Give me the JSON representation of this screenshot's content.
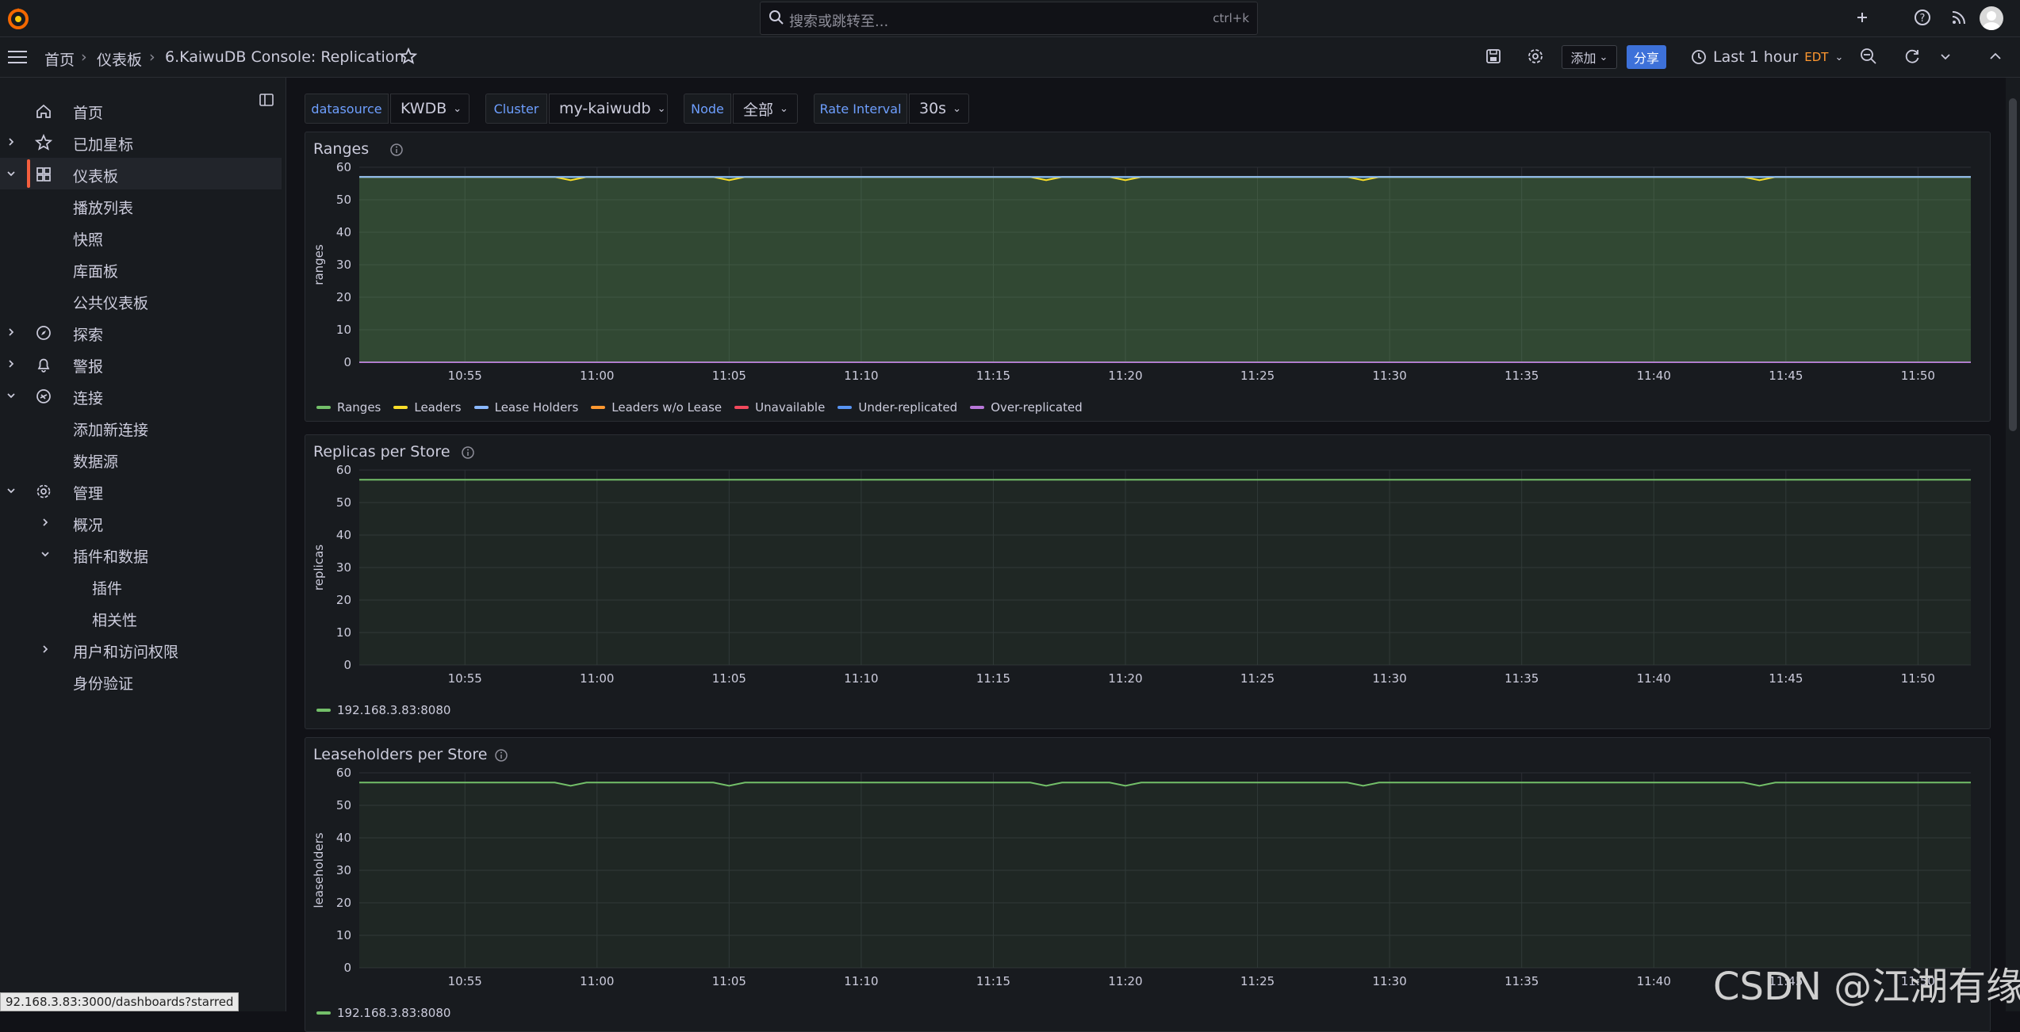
{
  "topbar": {
    "search_placeholder": "搜索或跳转至...",
    "search_shortcut": "ctrl+k"
  },
  "breadcrumb": [
    "首页",
    "仪表板",
    "6.KaiwuDB Console: Replication"
  ],
  "toolbar": {
    "add_label": "添加",
    "share_label": "分享",
    "time_range": "Last 1 hour",
    "timezone": "EDT"
  },
  "sidebar": {
    "items": [
      {
        "label": "首页",
        "icon": "home-icon"
      },
      {
        "label": "已加星标",
        "icon": "star-icon",
        "chevron": "right"
      },
      {
        "label": "仪表板",
        "icon": "dashboards-icon",
        "chevron": "down",
        "active": true
      },
      {
        "label": "播放列表"
      },
      {
        "label": "快照"
      },
      {
        "label": "库面板"
      },
      {
        "label": "公共仪表板"
      },
      {
        "label": "探索",
        "icon": "compass-icon",
        "chevron": "right"
      },
      {
        "label": "警报",
        "icon": "bell-icon",
        "chevron": "right"
      },
      {
        "label": "连接",
        "icon": "link-icon",
        "chevron": "down"
      },
      {
        "label": "添加新连接"
      },
      {
        "label": "数据源"
      },
      {
        "label": "管理",
        "icon": "gear-icon",
        "chevron": "down"
      },
      {
        "label": "概况",
        "chevron": "right"
      },
      {
        "label": "插件和数据",
        "chevron": "down"
      },
      {
        "label": "插件"
      },
      {
        "label": "相关性"
      },
      {
        "label": "用户和访问权限",
        "chevron": "right"
      },
      {
        "label": "身份验证"
      }
    ]
  },
  "variables": [
    {
      "label": "datasource",
      "value": "KWDB"
    },
    {
      "label": "Cluster",
      "value": "my-kaiwudb"
    },
    {
      "label": "Node",
      "value": "全部"
    },
    {
      "label": "Rate Interval",
      "value": "30s"
    }
  ],
  "colors": {
    "green": "#73bf69",
    "yellow": "#fade2a",
    "blue": "#8ab8ff",
    "orange": "#ff9830",
    "red": "#f2495c",
    "blue2": "#5794f2",
    "purple": "#b877d9",
    "accent": "#f55f3e"
  },
  "chart_data": [
    {
      "type": "line",
      "title": "Ranges",
      "ylabel": "ranges",
      "ylim": [
        0,
        60
      ],
      "yticks": [
        0,
        10,
        20,
        30,
        40,
        50,
        60
      ],
      "xticks": [
        "10:55",
        "11:00",
        "11:05",
        "11:10",
        "11:15",
        "11:20",
        "11:25",
        "11:30",
        "11:35",
        "11:40",
        "11:45",
        "11:50"
      ],
      "xrange": [
        "10:51",
        "11:52"
      ],
      "dips": [
        "10:59",
        "11:05",
        "11:17",
        "11:20",
        "11:29",
        "11:44"
      ],
      "legend": [
        "Ranges",
        "Leaders",
        "Lease Holders",
        "Leaders w/o Lease",
        "Unavailable",
        "Under-replicated",
        "Over-replicated"
      ],
      "series": [
        {
          "name": "Ranges",
          "color": "#73bf69",
          "value": 57,
          "fill": true
        },
        {
          "name": "Leaders",
          "color": "#fade2a",
          "value": 57,
          "dip_to": 56
        },
        {
          "name": "Lease Holders",
          "color": "#8ab8ff",
          "value": 57
        },
        {
          "name": "Leaders w/o Lease",
          "color": "#ff9830",
          "value": 0
        },
        {
          "name": "Unavailable",
          "color": "#f2495c",
          "value": 0
        },
        {
          "name": "Under-replicated",
          "color": "#5794f2",
          "value": 0
        },
        {
          "name": "Over-replicated",
          "color": "#b877d9",
          "value": 0
        }
      ]
    },
    {
      "type": "line",
      "title": "Replicas per Store",
      "ylabel": "replicas",
      "ylim": [
        0,
        60
      ],
      "yticks": [
        0,
        10,
        20,
        30,
        40,
        50,
        60
      ],
      "xticks": [
        "10:55",
        "11:00",
        "11:05",
        "11:10",
        "11:15",
        "11:20",
        "11:25",
        "11:30",
        "11:35",
        "11:40",
        "11:45",
        "11:50"
      ],
      "xrange": [
        "10:51",
        "11:52"
      ],
      "dips": [],
      "legend": [
        "192.168.3.83:8080"
      ],
      "series": [
        {
          "name": "192.168.3.83:8080",
          "color": "#73bf69",
          "value": 57,
          "fill": true
        }
      ]
    },
    {
      "type": "line",
      "title": "Leaseholders per Store",
      "ylabel": "leaseholders",
      "ylim": [
        0,
        60
      ],
      "yticks": [
        0,
        10,
        20,
        30,
        40,
        50,
        60
      ],
      "xticks": [
        "10:55",
        "11:00",
        "11:05",
        "11:10",
        "11:15",
        "11:20",
        "11:25",
        "11:30",
        "11:35",
        "11:40",
        "11:45",
        "11:50"
      ],
      "xrange": [
        "10:51",
        "11:52"
      ],
      "dips": [
        "10:59",
        "11:05",
        "11:17",
        "11:20",
        "11:29",
        "11:44"
      ],
      "legend": [
        "192.168.3.83:8080"
      ],
      "series": [
        {
          "name": "192.168.3.83:8080",
          "color": "#73bf69",
          "value": 57,
          "fill": true,
          "dip_to": 56
        }
      ]
    }
  ],
  "status_url": "92.168.3.83:3000/dashboards?starred",
  "watermark": "CSDN @江湖有缘"
}
